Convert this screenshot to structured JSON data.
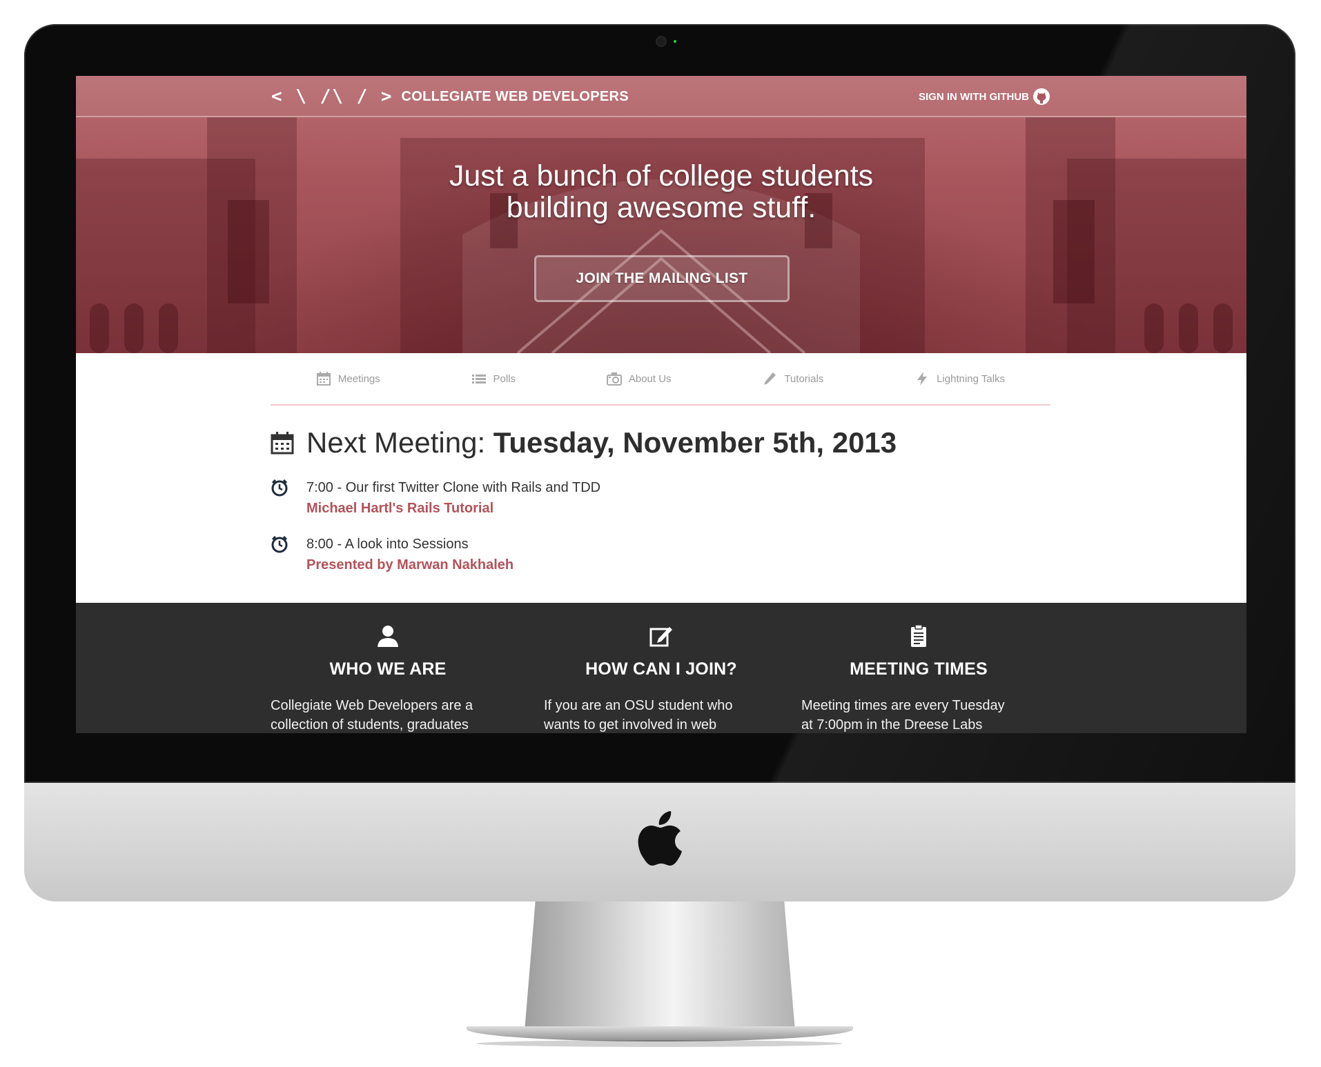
{
  "header": {
    "logo_glyph": "< \\ /\\ / >",
    "brand_name": "COLLEGIATE WEB DEVELOPERS",
    "signin_label": "SIGN IN WITH GITHUB"
  },
  "hero": {
    "line1": "Just a bunch of college students",
    "line2": "building awesome stuff.",
    "cta_label": "JOIN THE MAILING LIST"
  },
  "nav": {
    "items": [
      {
        "label": "Meetings",
        "icon": "calendar-icon"
      },
      {
        "label": "Polls",
        "icon": "list-icon"
      },
      {
        "label": "About Us",
        "icon": "camera-icon"
      },
      {
        "label": "Tutorials",
        "icon": "pencil-icon"
      },
      {
        "label": "Lightning Talks",
        "icon": "lightning-icon"
      }
    ]
  },
  "meeting": {
    "prefix": "Next Meeting:",
    "date": "Tuesday, November 5th, 2013",
    "talks": [
      {
        "title": "7:00 - Our first Twitter Clone with Rails and TDD",
        "link": "Michael Hartl's Rails Tutorial"
      },
      {
        "title": "8:00 - A look into Sessions",
        "link": "Presented by Marwan Nakhaleh"
      }
    ]
  },
  "info": {
    "columns": [
      {
        "title": "WHO WE ARE",
        "icon": "person-icon",
        "line1": "Collegiate Web Developers are a",
        "line2": "collection of students, graduates"
      },
      {
        "title": "HOW CAN I JOIN?",
        "icon": "edit-icon",
        "line1": "If you are an OSU student who",
        "line2": "wants to get involved in web"
      },
      {
        "title": "MEETING TIMES",
        "icon": "clipboard-icon",
        "line1": "Meeting times are every Tuesday",
        "line2": "at 7:00pm in the Dreese Labs"
      }
    ]
  },
  "colors": {
    "accent": "#b3525a",
    "hero_tint": "#a9575d",
    "dark_section": "#2e2e2e",
    "nav_divider": "#f0c9cc"
  }
}
